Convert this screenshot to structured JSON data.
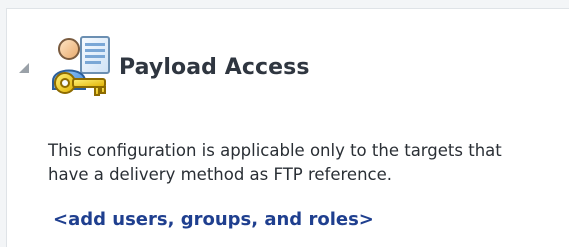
{
  "section": {
    "title": "Payload Access",
    "icon": "user-key-icon",
    "collapse_icon": "collapse-triangle-icon"
  },
  "description": {
    "line1": "This configuration is applicable only to the targets that",
    "line2": "have a delivery method as FTP reference."
  },
  "actions": {
    "add_link_label": "<add users, groups, and roles>"
  },
  "colors": {
    "title": "#2f3640",
    "link": "#1f3f8f",
    "text": "#2a2f35",
    "panel_bg": "#ffffff",
    "page_bg": "#f3f5f7"
  }
}
